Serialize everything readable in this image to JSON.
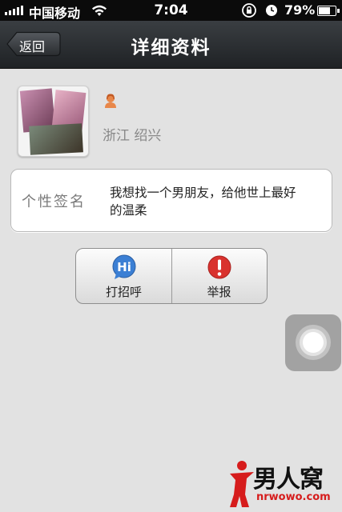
{
  "status_bar": {
    "carrier": "中国移动",
    "time": "7:04",
    "battery": "79%",
    "battery_level": 0.79,
    "icons": [
      "signal-icon",
      "wifi-icon",
      "rotation-lock-icon",
      "alarm-icon",
      "battery-icon"
    ]
  },
  "nav": {
    "back_label": "返回",
    "title": "详细资料"
  },
  "profile": {
    "gender_icon": "female-icon",
    "location": "浙江  绍兴"
  },
  "signature": {
    "label": "个性签名",
    "text": "我想找一个男朋友，给他世上最好的温柔"
  },
  "actions": {
    "greet_label": "打招呼",
    "greet_icon": "hi-icon",
    "report_label": "举报",
    "report_icon": "warning-icon"
  },
  "watermark": {
    "text": "男人窝",
    "url": "nrwowo.com"
  },
  "colors": {
    "background": "#e2e2e2",
    "nav_bar": "#2b2e31",
    "greet_icon": "#3b7fd4",
    "report_icon": "#d9322e",
    "watermark_red": "#d61c1c"
  }
}
